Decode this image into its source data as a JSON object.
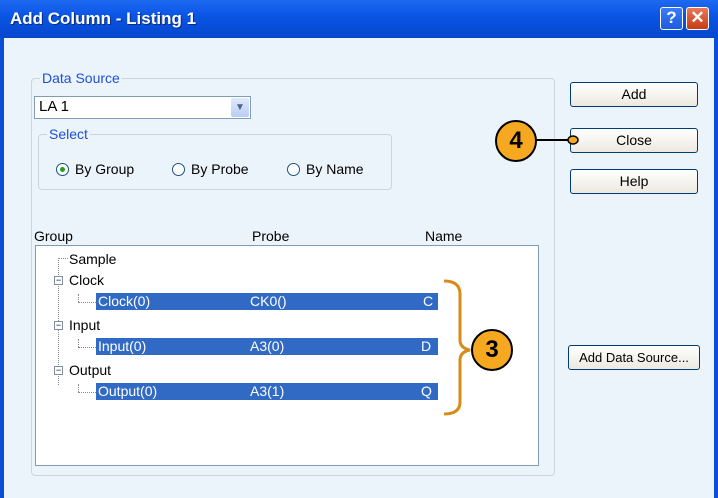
{
  "window": {
    "title": "Add Column - Listing 1"
  },
  "data_source": {
    "legend": "Data Source",
    "selected": "LA 1",
    "select": {
      "legend": "Select",
      "options": [
        "By Group",
        "By Probe",
        "By Name"
      ],
      "selected": "By Group"
    }
  },
  "columns": {
    "group": "Group",
    "probe": "Probe",
    "name": "Name"
  },
  "tree": {
    "sample": "Sample",
    "clock": "Clock",
    "clock_row": {
      "group": "Clock(0)",
      "probe": "CK0()",
      "name": "C"
    },
    "input": "Input",
    "input_row": {
      "group": "Input(0)",
      "probe": "A3(0)",
      "name": "D"
    },
    "output": "Output",
    "output_row": {
      "group": "Output(0)",
      "probe": "A3(1)",
      "name": "Q"
    }
  },
  "buttons": {
    "add": "Add",
    "close": "Close",
    "help": "Help",
    "add_data_source": "Add Data Source..."
  },
  "callouts": {
    "close_step": "4",
    "rows_step": "3"
  },
  "colors": {
    "callout": "#f6a821",
    "selection": "#316ac5",
    "titlebar": "#0a55e5"
  }
}
